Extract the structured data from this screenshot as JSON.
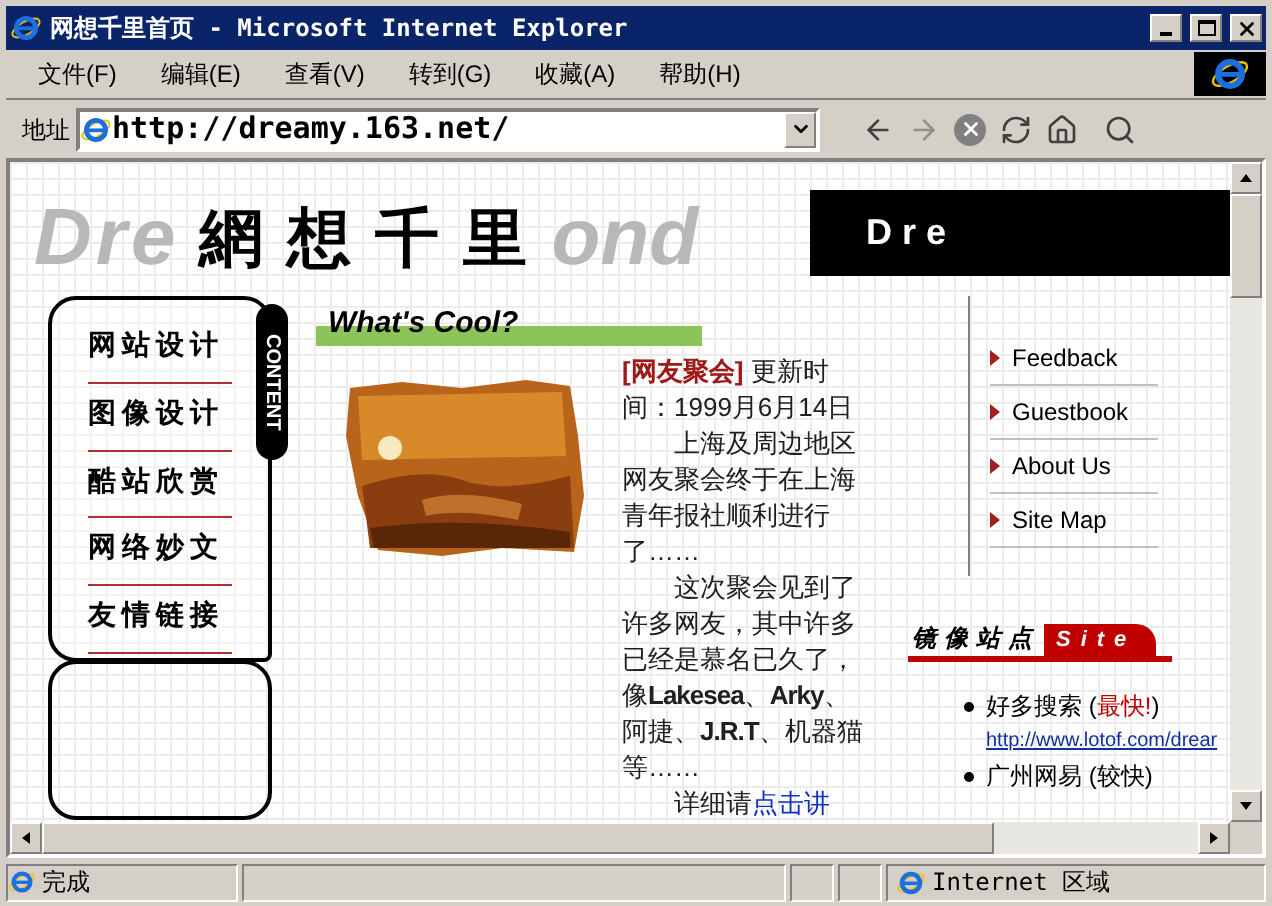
{
  "window": {
    "title": "网想千里首页 - Microsoft Internet Explorer"
  },
  "menu": [
    {
      "label": "文件(F)"
    },
    {
      "label": "编辑(E)"
    },
    {
      "label": "查看(V)"
    },
    {
      "label": "转到(G)"
    },
    {
      "label": "收藏(A)"
    },
    {
      "label": "帮助(H)"
    }
  ],
  "address": {
    "label": "地址",
    "value": "http://dreamy.163.net/"
  },
  "page": {
    "logo": {
      "lead": "Dre",
      "title": "網想千里",
      "tail": "ond"
    },
    "banner": "Dre",
    "nav": {
      "tab": "CONTENT",
      "items": [
        "网站设计",
        "图像设计",
        "酷站欣赏",
        "网络妙文",
        "友情链接"
      ]
    },
    "section_title": "What's Cool?",
    "article": {
      "tag": "[网友聚会]",
      "date": "更新时间：1999月6月14日",
      "paragraphs": [
        "上海及周边地区网友聚会终于在上海青年报社顺利进行了……",
        "这次聚会见到了许多网友，其中许多已经是慕名已久了，像**Lakesea**、**Arky**、阿捷、**J.R.T**、机器猫等……"
      ],
      "more": "详细请",
      "more_link": "点击讲"
    },
    "links": [
      "Feedback",
      "Guestbook",
      "About Us",
      "Site Map"
    ],
    "mirror": {
      "title": "镜像站点",
      "badge": "Site",
      "sites": [
        {
          "parts": [
            {
              "text": "好多搜索 (",
              "hot": false
            },
            {
              "text": "最快!",
              "hot": true
            },
            {
              "text": ")",
              "hot": false
            }
          ],
          "url": "http://www.lotof.com/drear"
        },
        {
          "parts": [
            {
              "text": "广州网易 (较快)",
              "hot": false
            }
          ]
        }
      ]
    }
  },
  "status": {
    "text": "完成",
    "zone": "Internet 区域"
  }
}
